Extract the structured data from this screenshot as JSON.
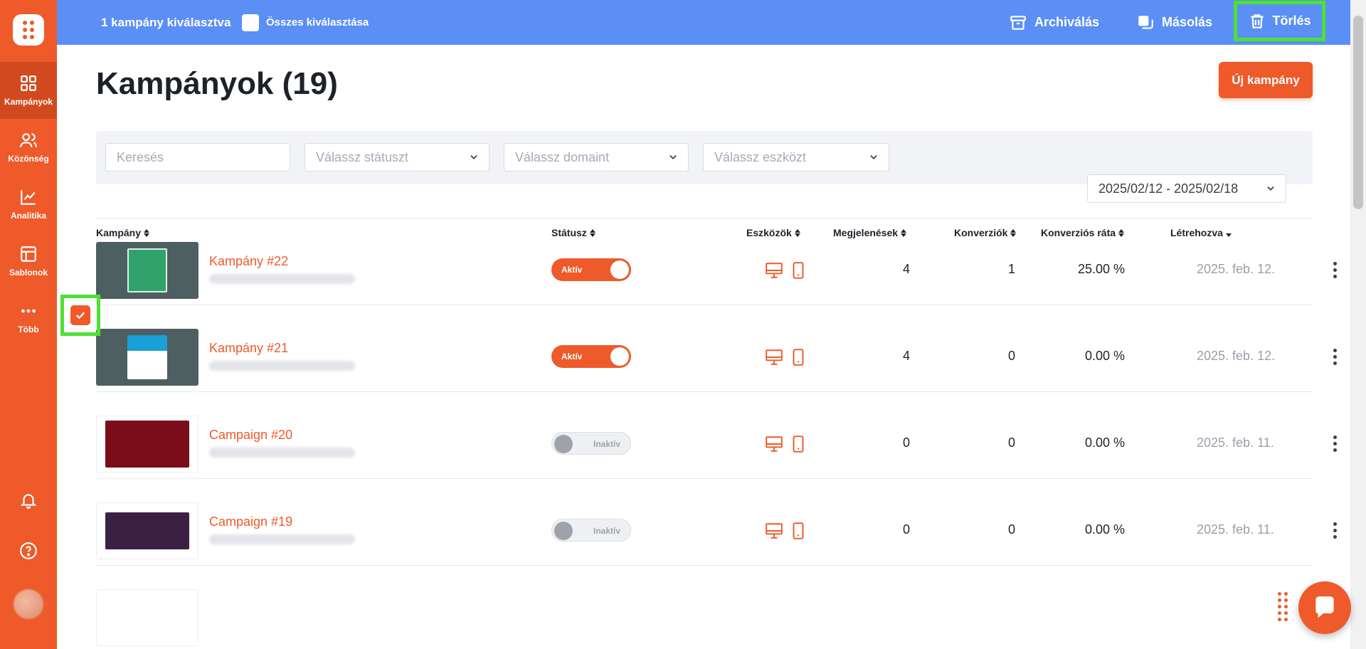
{
  "colors": {
    "accent": "#ee5a2a",
    "topbar": "#5b8ff5",
    "highlight": "#4ee034"
  },
  "sidebar": {
    "items": [
      {
        "label": "Kampányok",
        "icon": "grid-icon",
        "active": true
      },
      {
        "label": "Közönség",
        "icon": "users-icon",
        "active": false
      },
      {
        "label": "Analitika",
        "icon": "chart-icon",
        "active": false
      },
      {
        "label": "Sablonok",
        "icon": "layout-icon",
        "active": false
      },
      {
        "label": "Több",
        "icon": "more-dots-icon",
        "active": false
      }
    ]
  },
  "topbar": {
    "selected_count": "1 kampány kiválasztva",
    "select_all": "Összes kiválasztása",
    "archive": "Archiválás",
    "copy": "Másolás",
    "delete": "Törlés"
  },
  "page": {
    "title": "Kampányok (19)",
    "new_button": "Új kampány"
  },
  "filters": {
    "search_placeholder": "Keresés",
    "status_placeholder": "Válassz státuszt",
    "domain_placeholder": "Válassz domaint",
    "device_placeholder": "Válassz eszközt",
    "date_range": "2025/02/12 - 2025/02/18"
  },
  "table": {
    "headers": {
      "campaign": "Kampány",
      "status": "Státusz",
      "devices": "Eszközök",
      "impressions": "Megjelenések",
      "conversions": "Konverziók",
      "rate": "Konverziós ráta",
      "created": "Létrehozva"
    },
    "rows": [
      {
        "name": "Kampány #22",
        "status": "Aktív",
        "active": true,
        "impressions": "4",
        "conversions": "1",
        "rate": "25.00 %",
        "created": "2025. feb. 12.",
        "selected": true
      },
      {
        "name": "Kampány #21",
        "status": "Aktív",
        "active": true,
        "impressions": "4",
        "conversions": "0",
        "rate": "0.00 %",
        "created": "2025. feb. 12.",
        "selected": false
      },
      {
        "name": "Campaign #20",
        "status": "Inaktív",
        "active": false,
        "impressions": "0",
        "conversions": "0",
        "rate": "0.00 %",
        "created": "2025. feb. 11.",
        "selected": false
      },
      {
        "name": "Campaign #19",
        "status": "Inaktív",
        "active": false,
        "impressions": "0",
        "conversions": "0",
        "rate": "0.00 %",
        "created": "2025. feb. 11.",
        "selected": false
      }
    ]
  }
}
